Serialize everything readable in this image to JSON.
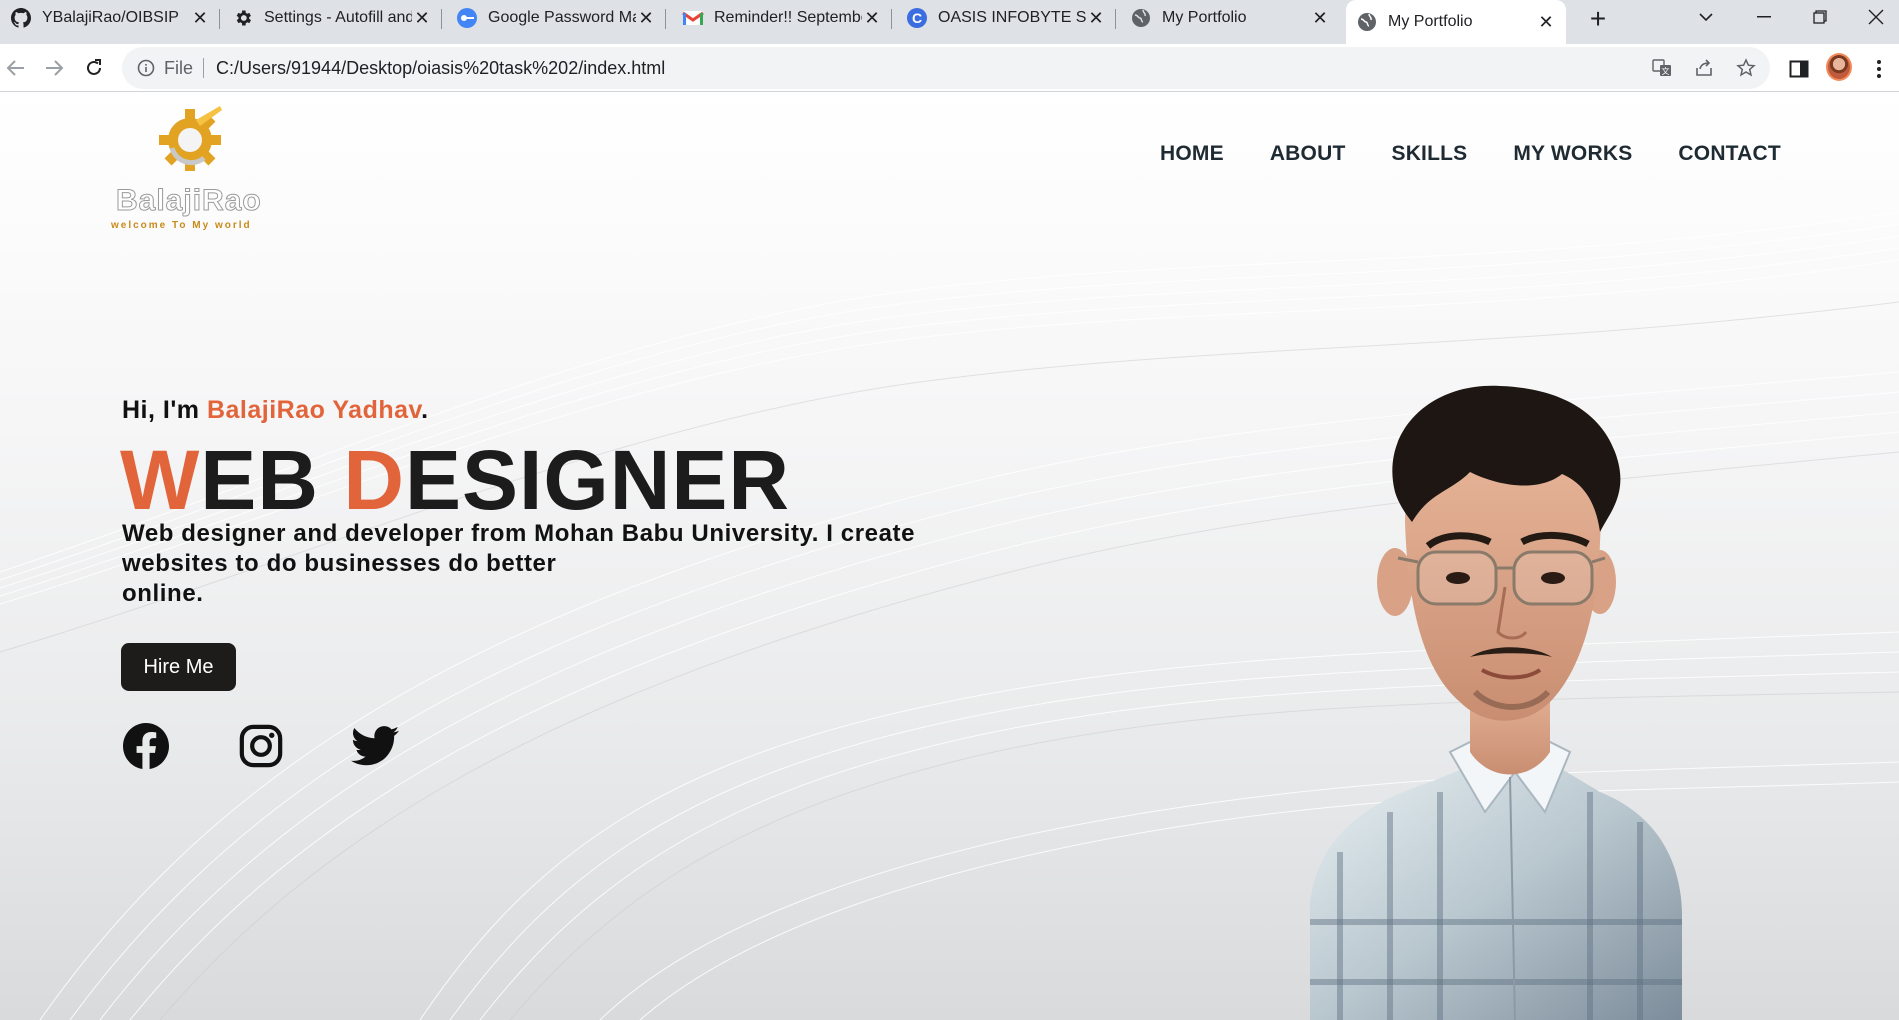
{
  "browser": {
    "tabs": [
      {
        "title": "YBalajiRao/OIBSIP",
        "icon": "github-icon"
      },
      {
        "title": "Settings - Autofill and",
        "icon": "settings-gear-icon"
      },
      {
        "title": "Google Password Ma",
        "icon": "google-password-icon"
      },
      {
        "title": "Reminder!! Septembe",
        "icon": "gmail-icon"
      },
      {
        "title": "OASIS INFOBYTE SIP",
        "icon": "oasis-icon"
      },
      {
        "title": "My Portfolio",
        "icon": "globe-icon"
      },
      {
        "title": "My Portfolio",
        "icon": "globe-icon",
        "active": true
      }
    ],
    "omnibox": {
      "scheme_label": "File",
      "url": "C:/Users/91944/Desktop/oiasis%20task%202/index.html"
    }
  },
  "site": {
    "logo": {
      "name": "BalajiRao",
      "tagline": "welcome To My world"
    },
    "nav": [
      "HOME",
      "ABOUT",
      "SKILLS",
      "MY WORKS",
      "CONTACT"
    ],
    "hero": {
      "greeting_prefix": "Hi, I'm ",
      "greeting_name": "BalajiRao Yadhav",
      "greeting_suffix": ".",
      "headline_w": "W",
      "headline_eb": "EB ",
      "headline_d": "D",
      "headline_esigner": "ESIGNER",
      "description_line1": "Web designer and developer from Mohan Babu University. I create",
      "description_line2": "websites to do businesses do better",
      "description_line3": "online.",
      "cta_label": "Hire Me"
    },
    "social": [
      "facebook-icon",
      "instagram-icon",
      "twitter-icon"
    ]
  },
  "colors": {
    "accent": "#e2643a",
    "nav_text": "#1f2b33",
    "button_bg": "#1e1c1a",
    "tabstrip_bg": "#dee1e6"
  }
}
